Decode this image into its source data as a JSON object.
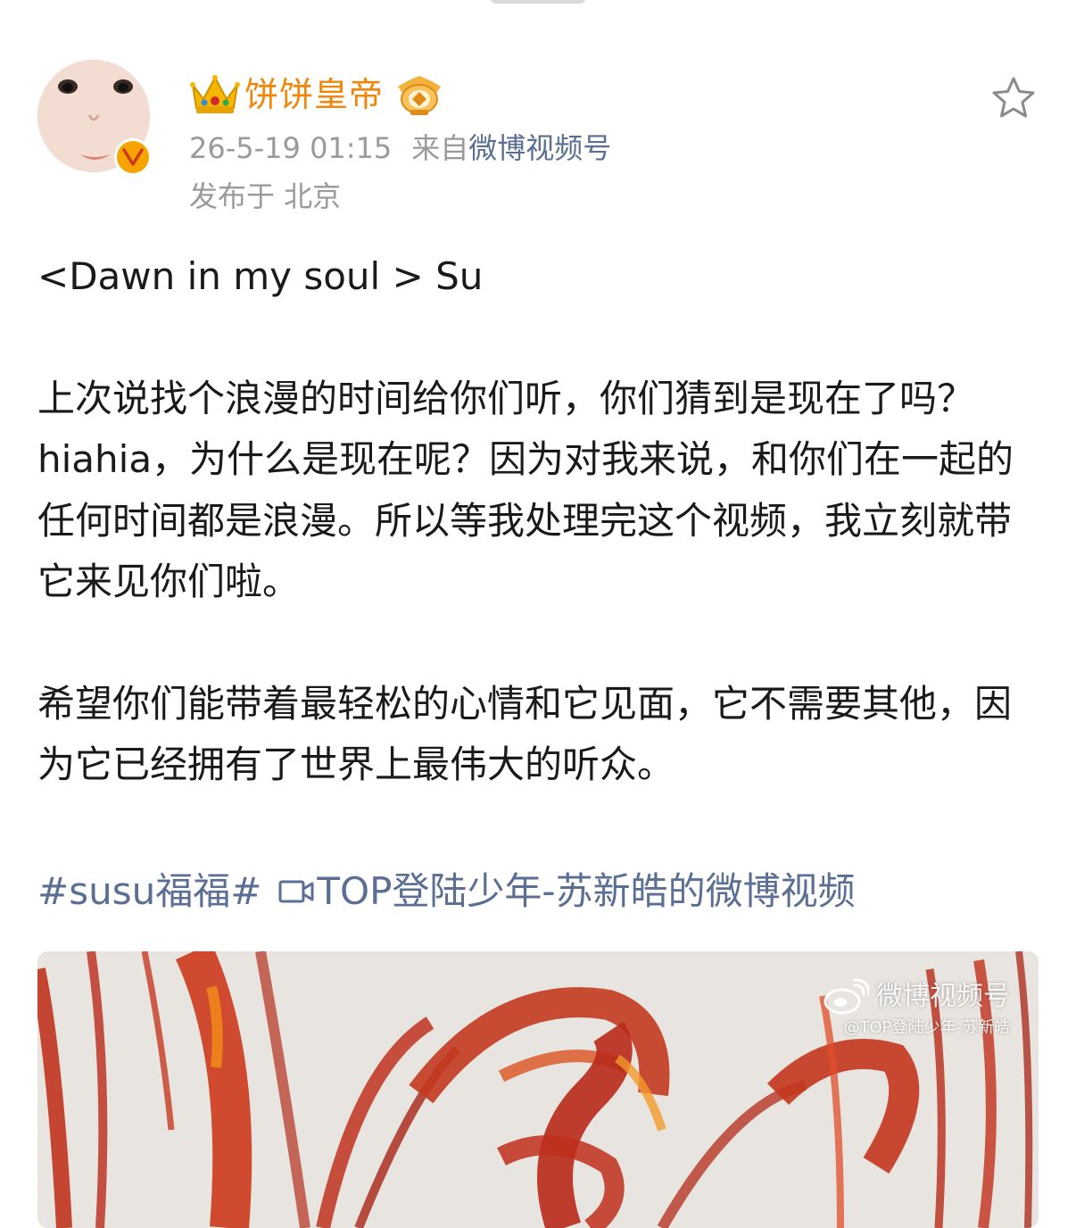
{
  "post": {
    "author": {
      "name": "饼饼皇帝",
      "avatar_icon": "avatar-photo",
      "verified_badge_icon": "verified-v-icon",
      "crown_icon": "crown-icon",
      "vip_icon": "vip-badge-icon"
    },
    "meta": {
      "time": "26-5-19 01:15",
      "source_prefix": "来自",
      "source": "微博视频号",
      "location": "发布于 北京"
    },
    "favorite_icon": "star-icon",
    "content": {
      "title_line": "<Dawn in my soul > Su",
      "paragraph1": "上次说找个浪漫的时间给你们听，你们猜到是现在了吗？hiahia，为什么是现在呢？因为对我来说，和你们在一起的任何时间都是浪漫。所以等我处理完这个视频，我立刻就带它来见你们啦。",
      "paragraph2": "希望你们能带着最轻松的心情和它见面，它不需要其他，因为它已经拥有了世界上最伟大的听众。",
      "hashtag": "#susu福福#",
      "video_link": "TOP登陆少年-苏新皓的微博视频"
    },
    "video": {
      "watermark_title": "微博视频号",
      "watermark_sub": "@TOP登陆少年-苏新皓"
    }
  },
  "colors": {
    "username": "#f0870b",
    "link": "#5b6f94",
    "meta": "#9a9a9a",
    "badge": "#f7a400"
  }
}
